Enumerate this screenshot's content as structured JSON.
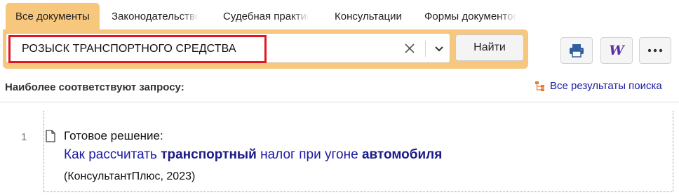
{
  "tabs": [
    {
      "label": "Все документы"
    },
    {
      "label": "Законодательство"
    },
    {
      "label": "Судебная практика"
    },
    {
      "label": "Консультации"
    },
    {
      "label": "Формы документов"
    }
  ],
  "search": {
    "query": "РОЗЫСК ТРАНСПОРТНОГО СРЕДСТВА",
    "find_label": "Найти"
  },
  "toolbar": {
    "print_icon": "printer-icon",
    "word_icon": "word-export-icon",
    "word_glyph": "W",
    "more_icon": "more-dots-icon",
    "more_glyph": "•••"
  },
  "section": {
    "title": "Наиболее соответствуют запросу:",
    "all_results": "Все результаты поиска"
  },
  "results": [
    {
      "number": "1",
      "kind": "Готовое решение:",
      "title_parts": [
        "Как рассчитать ",
        "транспортный",
        " налог при угоне ",
        "автомобиля"
      ],
      "source": "(КонсультантПлюс, 2023)"
    }
  ],
  "colors": {
    "accent": "#f8c77e",
    "highlight_border": "#e3161f",
    "link": "#1a1aa6",
    "word_icon": "#5c2fa6",
    "tree_icon": "#e87b2e"
  }
}
